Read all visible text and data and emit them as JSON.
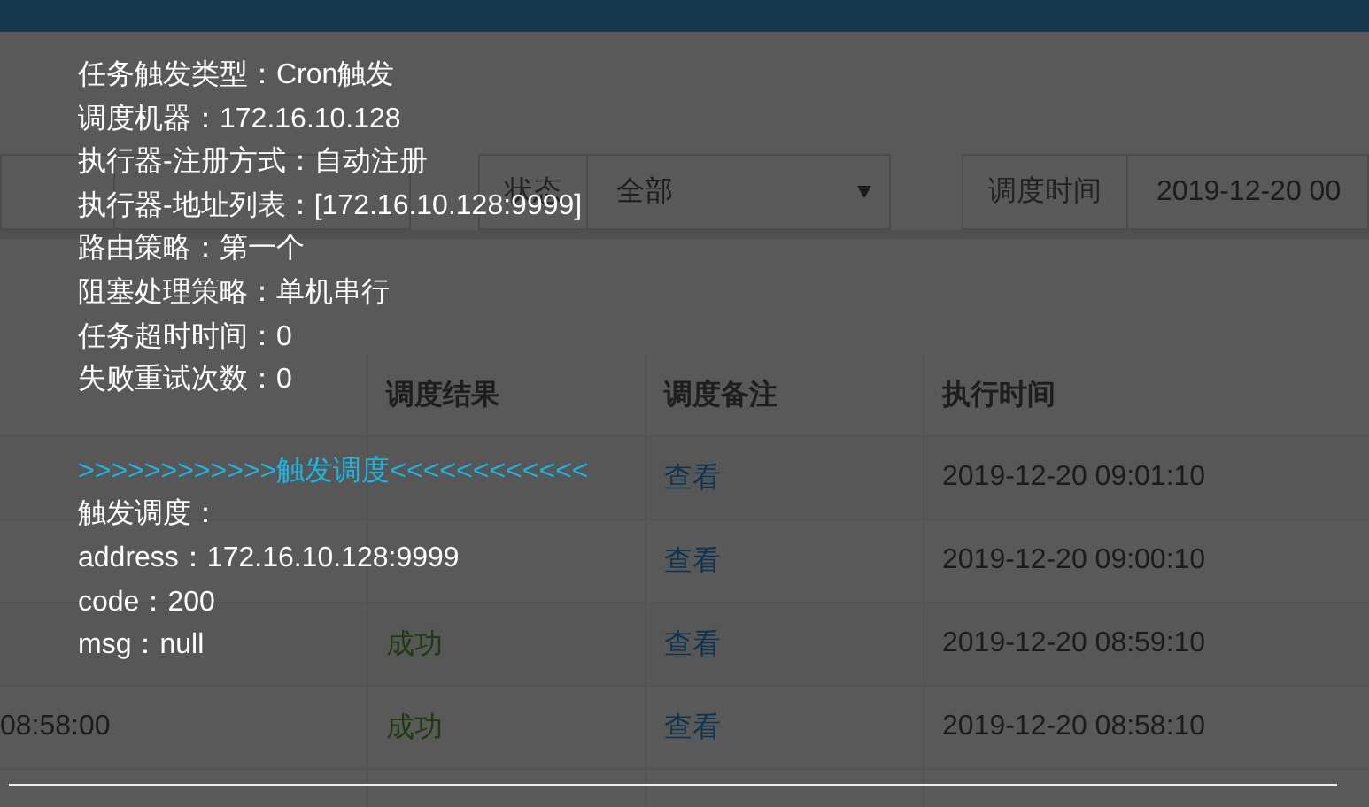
{
  "filters": [
    {
      "label": "状态",
      "value": "全部",
      "kind": "select"
    },
    {
      "label": "调度时间",
      "value": "2019-12-20 00",
      "kind": "input"
    }
  ],
  "table": {
    "columns": [
      "调度结果",
      "调度备注",
      "执行时间"
    ],
    "rows": [
      {
        "note": "查看",
        "exec_time": "2019-12-20 09:01:10"
      },
      {
        "note": "查看",
        "exec_time": "2019-12-20 09:00:10"
      },
      {
        "result": "成功",
        "note": "查看",
        "exec_time": "2019-12-20 08:59:10"
      },
      {
        "column_1": "08:58:00",
        "result": "成功",
        "note": "查看",
        "exec_time": "2019-12-20 08:58:10"
      }
    ]
  },
  "tooltip": {
    "lines": [
      {
        "kind": "text",
        "text": "任务触发类型：Cron触发"
      },
      {
        "kind": "text",
        "text": "调度机器：172.16.10.128"
      },
      {
        "kind": "text",
        "text": "执行器-注册方式：自动注册"
      },
      {
        "kind": "text",
        "text": "执行器-地址列表：[172.16.10.128:9999]"
      },
      {
        "kind": "text",
        "text": "路由策略：第一个"
      },
      {
        "kind": "text",
        "text": "阻塞处理策略：单机串行"
      },
      {
        "kind": "text",
        "text": "任务超时时间：0"
      },
      {
        "kind": "text",
        "text": "失败重试次数：0"
      },
      {
        "kind": "heading",
        "text": ">>>>>>>>>>>>触发调度<<<<<<<<<<<<"
      },
      {
        "kind": "text",
        "text": "触发调度："
      },
      {
        "kind": "text",
        "text": "address：172.16.10.128:9999"
      },
      {
        "kind": "text",
        "text": "code：200"
      },
      {
        "kind": "text",
        "text": "msg：null"
      }
    ]
  }
}
